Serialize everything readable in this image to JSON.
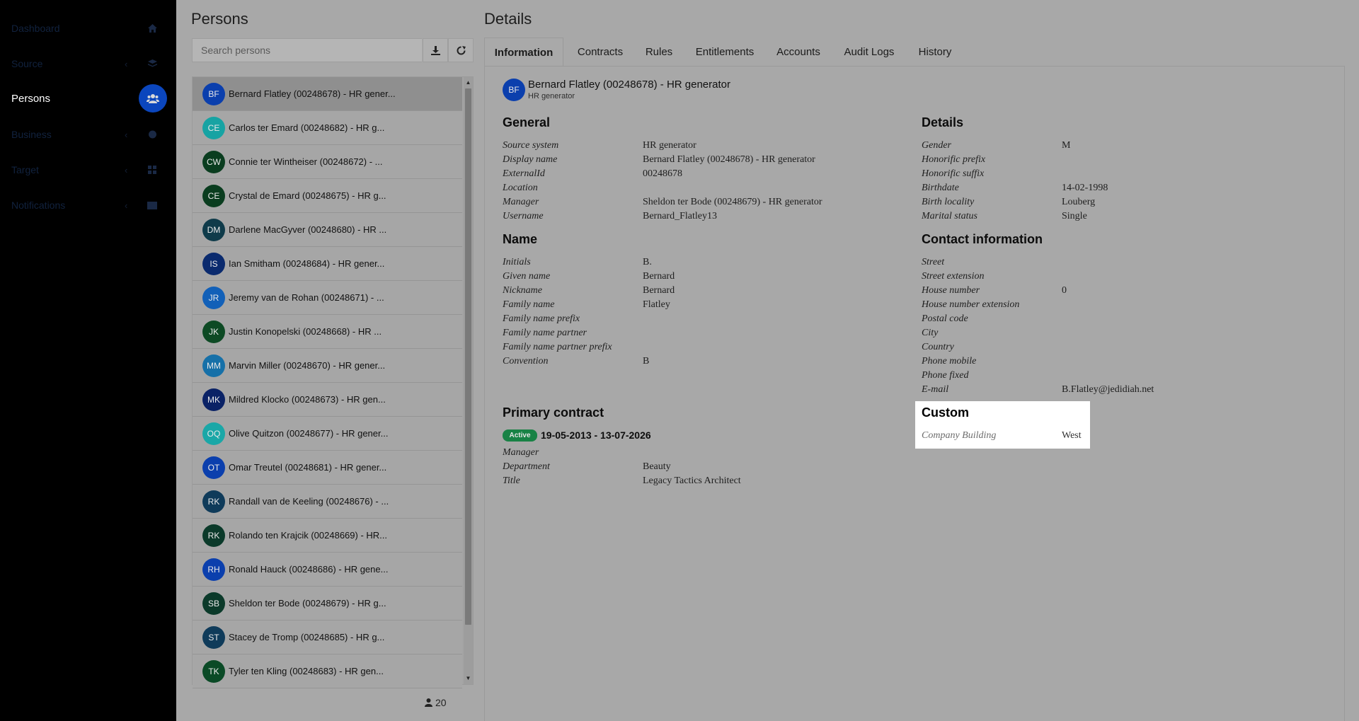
{
  "sidebar": {
    "items": [
      {
        "label": "Dashboard",
        "icon": "home-icon",
        "chevron": ""
      },
      {
        "label": "Source",
        "icon": "layers-icon",
        "chevron": "‹"
      },
      {
        "label": "Persons",
        "icon": "users-icon",
        "chevron": ""
      },
      {
        "label": "Business",
        "icon": "sitemap-icon",
        "chevron": "‹"
      },
      {
        "label": "Target",
        "icon": "grid-icon",
        "chevron": "‹"
      },
      {
        "label": "Notifications",
        "icon": "envelope-icon",
        "chevron": "‹"
      }
    ],
    "active": "Persons"
  },
  "persons": {
    "title": "Persons",
    "search_placeholder": "Search persons",
    "count": "20",
    "items": [
      {
        "initials": "BF",
        "name": "Bernard Flatley (00248678) - HR gener...",
        "color": "#0b3fad"
      },
      {
        "initials": "CE",
        "name": "Carlos ter Emard (00248682) - HR g...",
        "color": "#17a3a3"
      },
      {
        "initials": "CW",
        "name": "Connie ter Wintheiser (00248672) - ...",
        "color": "#0a3d1f"
      },
      {
        "initials": "CE",
        "name": "Crystal de Emard (00248675) - HR g...",
        "color": "#0a3d1f"
      },
      {
        "initials": "DM",
        "name": "Darlene MacGyver (00248680) - HR ...",
        "color": "#0f3b4a"
      },
      {
        "initials": "IS",
        "name": "Ian Smitham (00248684) - HR gener...",
        "color": "#0a2a6e"
      },
      {
        "initials": "JR",
        "name": "Jeremy van de Rohan (00248671) - ...",
        "color": "#1260b8"
      },
      {
        "initials": "JK",
        "name": "Justin Konopelski (00248668) - HR ...",
        "color": "#0d4a24"
      },
      {
        "initials": "MM",
        "name": "Marvin Miller (00248670) - HR gener...",
        "color": "#1670a8"
      },
      {
        "initials": "MK",
        "name": "Mildred Klocko (00248673) - HR gen...",
        "color": "#0a2266"
      },
      {
        "initials": "OQ",
        "name": "Olive Quitzon (00248677) - HR gener...",
        "color": "#1aa7a7"
      },
      {
        "initials": "OT",
        "name": "Omar Treutel (00248681) - HR gener...",
        "color": "#0b3fad"
      },
      {
        "initials": "RK",
        "name": "Randall van de Keeling (00248676) - ...",
        "color": "#0f3b5a"
      },
      {
        "initials": "RK",
        "name": "Rolando ten Krajcik (00248669) - HR...",
        "color": "#0b3a2a"
      },
      {
        "initials": "RH",
        "name": "Ronald Hauck (00248686) - HR gene...",
        "color": "#0b3fad"
      },
      {
        "initials": "SB",
        "name": "Sheldon ter Bode (00248679) - HR g...",
        "color": "#0b3a2a"
      },
      {
        "initials": "ST",
        "name": "Stacey de Tromp (00248685) - HR g...",
        "color": "#0f3b5a"
      },
      {
        "initials": "TK",
        "name": "Tyler ten Kling (00248683) - HR gen...",
        "color": "#0a4a26"
      }
    ]
  },
  "details": {
    "title": "Details",
    "tabs": [
      "Information",
      "Contracts",
      "Rules",
      "Entitlements",
      "Accounts",
      "Audit Logs",
      "History"
    ],
    "active_tab": "Information",
    "header": {
      "initials": "BF",
      "name": "Bernard Flatley (00248678) - HR generator",
      "sub": "HR generator"
    },
    "general": {
      "title": "General",
      "rows": [
        {
          "label": "Source system",
          "value": "HR generator"
        },
        {
          "label": "Display name",
          "value": "Bernard Flatley (00248678) - HR generator"
        },
        {
          "label": "ExternalId",
          "value": "00248678"
        },
        {
          "label": "Location",
          "value": ""
        },
        {
          "label": "Manager",
          "value": "Sheldon ter Bode (00248679) - HR generator"
        },
        {
          "label": "Username",
          "value": "Bernard_Flatley13"
        }
      ]
    },
    "name": {
      "title": "Name",
      "rows": [
        {
          "label": "Initials",
          "value": "B."
        },
        {
          "label": "Given name",
          "value": "Bernard"
        },
        {
          "label": "Nickname",
          "value": "Bernard"
        },
        {
          "label": "Family name",
          "value": "Flatley"
        },
        {
          "label": "Family name prefix",
          "value": ""
        },
        {
          "label": "Family name partner",
          "value": ""
        },
        {
          "label": "Family name partner prefix",
          "value": ""
        },
        {
          "label": "Convention",
          "value": "B"
        }
      ]
    },
    "primary_contract": {
      "title": "Primary contract",
      "status": "Active",
      "range": "19-05-2013 - 13-07-2026",
      "rows": [
        {
          "label": "Manager",
          "value": ""
        },
        {
          "label": "Department",
          "value": "Beauty"
        },
        {
          "label": "Title",
          "value": "Legacy Tactics Architect"
        }
      ]
    },
    "details_section": {
      "title": "Details",
      "rows": [
        {
          "label": "Gender",
          "value": "M"
        },
        {
          "label": "Honorific prefix",
          "value": ""
        },
        {
          "label": "Honorific suffix",
          "value": ""
        },
        {
          "label": "Birthdate",
          "value": "14-02-1998"
        },
        {
          "label": "Birth locality",
          "value": "Louberg"
        },
        {
          "label": "Marital status",
          "value": "Single"
        }
      ]
    },
    "contact": {
      "title": "Contact information",
      "rows": [
        {
          "label": "Street",
          "value": ""
        },
        {
          "label": "Street extension",
          "value": ""
        },
        {
          "label": "House number",
          "value": "0"
        },
        {
          "label": "House number extension",
          "value": ""
        },
        {
          "label": "Postal code",
          "value": ""
        },
        {
          "label": "City",
          "value": ""
        },
        {
          "label": "Country",
          "value": ""
        },
        {
          "label": "Phone mobile",
          "value": ""
        },
        {
          "label": "Phone fixed",
          "value": ""
        },
        {
          "label": "E-mail",
          "value": "B.Flatley@jedidiah.net"
        }
      ]
    },
    "custom": {
      "title": "Custom",
      "rows": [
        {
          "label": "Company Building",
          "value": "West"
        }
      ]
    }
  }
}
